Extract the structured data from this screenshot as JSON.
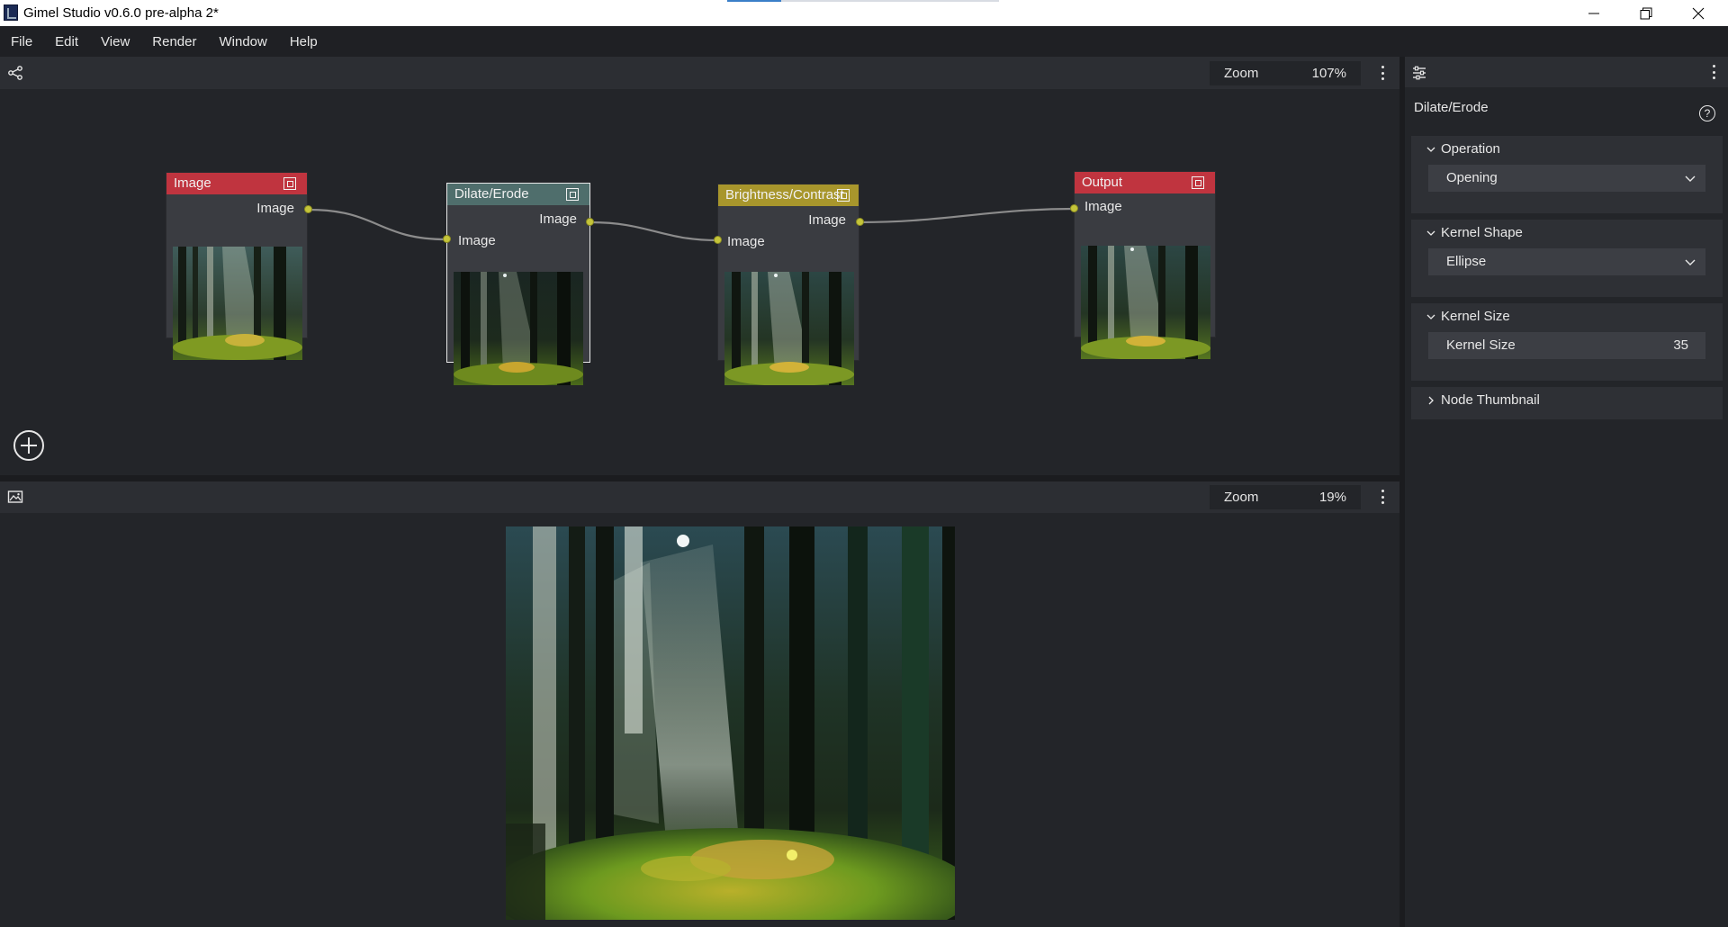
{
  "window": {
    "title": "Gimel Studio v0.6.0 pre-alpha 2*",
    "controls": [
      "minimize-icon",
      "restore-icon",
      "close-icon"
    ]
  },
  "menu": [
    "File",
    "Edit",
    "View",
    "Render",
    "Window",
    "Help"
  ],
  "node_editor": {
    "toolbar_icon": "node-graph-icon",
    "zoom_label": "Zoom",
    "zoom_value": "107%",
    "nodes": [
      {
        "name": "Image",
        "header_color": "#c0343f",
        "outputs": [
          "Image"
        ],
        "inputs": []
      },
      {
        "name": "Dilate/Erode",
        "header_color": "#4f6e6c",
        "outputs": [
          "Image"
        ],
        "inputs": [
          "Image"
        ],
        "selected": true
      },
      {
        "name": "Brightness/Contrast",
        "header_color": "#a8962c",
        "outputs": [
          "Image"
        ],
        "inputs": [
          "Image"
        ]
      },
      {
        "name": "Output",
        "header_color": "#c0343f",
        "outputs": [],
        "inputs": [
          "Image"
        ]
      }
    ],
    "add_node_icon": "add-circle-icon"
  },
  "image_viewer": {
    "toolbar_icon": "image-icon",
    "zoom_label": "Zoom",
    "zoom_value": "19%"
  },
  "properties": {
    "toolbar_icon": "sliders-icon",
    "node_title": "Dilate/Erode",
    "help_icon": "help-icon",
    "help_glyph": "?",
    "sections": [
      {
        "label": "Operation",
        "expanded": true,
        "value": "Opening"
      },
      {
        "label": "Kernel Shape",
        "expanded": true,
        "value": "Ellipse"
      },
      {
        "label": "Kernel Size",
        "expanded": true,
        "field_label": "Kernel Size",
        "value": "35"
      },
      {
        "label": "Node Thumbnail",
        "expanded": false
      }
    ]
  },
  "colors": {
    "socket": "#c4c43a",
    "wire": "#8c8c8c",
    "panel_bg": "#232529",
    "toolbar_bg": "#2c2e33"
  }
}
